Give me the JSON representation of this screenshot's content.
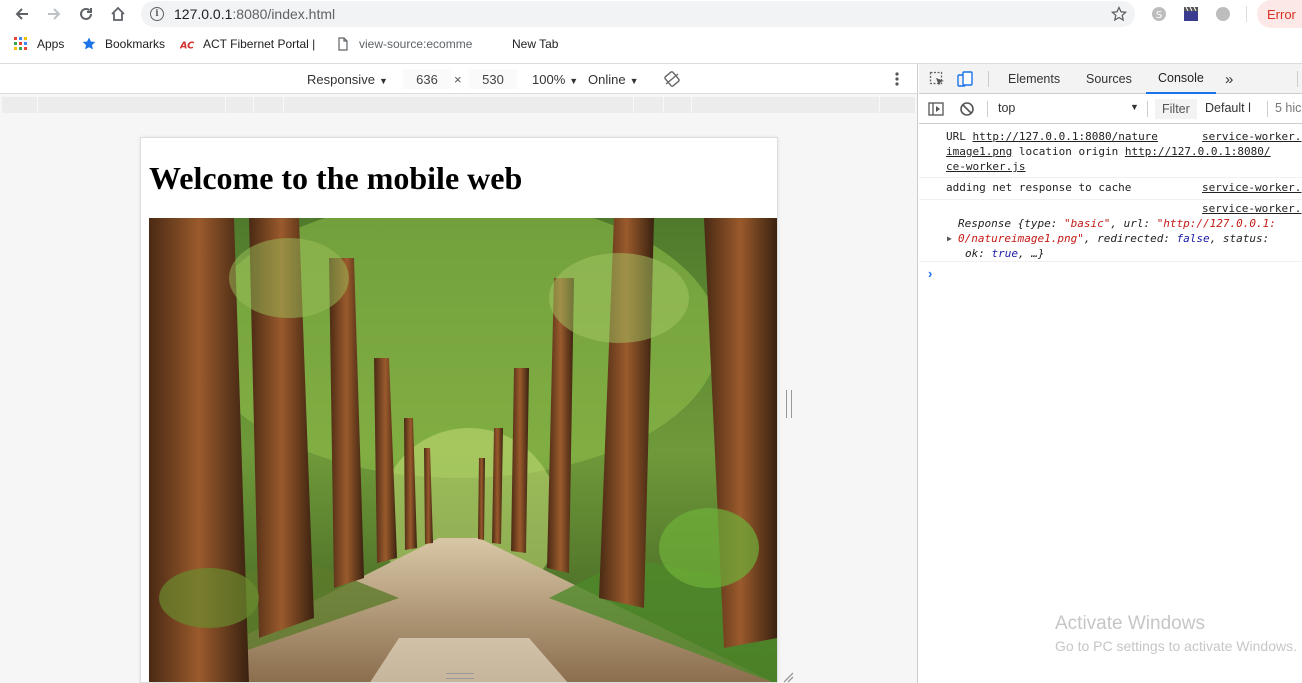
{
  "browser": {
    "url_host": "127.0.0.1",
    "url_rest": ":8080/index.html",
    "error_label": "Error"
  },
  "bookmarks": [
    {
      "label": "Apps",
      "icon": "apps-grid-icon"
    },
    {
      "label": "Bookmarks",
      "icon": "star-icon"
    },
    {
      "label": "ACT Fibernet Portal |",
      "icon": "act-logo-icon"
    },
    {
      "label": "view-source:ecomme",
      "icon": "page-icon"
    },
    {
      "label": "New Tab",
      "icon": ""
    }
  ],
  "device_toolbar": {
    "mode": "Responsive",
    "width": "636",
    "times": "×",
    "height": "530",
    "zoom": "100%",
    "network": "Online"
  },
  "page": {
    "heading": "Welcome to the mobile web"
  },
  "devtools": {
    "tabs": [
      "Elements",
      "Sources",
      "Console"
    ],
    "active_tab": "Console",
    "more": "»",
    "context": "top",
    "filter_placeholder": "Filter",
    "levels": "Default l",
    "hidden": "5 hic"
  },
  "console": {
    "log1": {
      "l1_text": "URL ",
      "l1_link": "http://127.0.0.1:8080/nature",
      "l2_link": "image1.png",
      "l2_text": " location origin ",
      "l2_link2": "http://127.0.0.1:8080/",
      "l3_link": "ce-worker.js",
      "source": "service-worker.j"
    },
    "log2": {
      "text": "adding net response to cache",
      "source": "service-worker.j"
    },
    "log3": {
      "source": "service-worker.j",
      "l1_a": "Response {type: ",
      "l1_b": "\"basic\"",
      "l1_c": ", url: ",
      "l1_d": "\"http://127.0.0.1:",
      "l2_a": "0/natureimage1.png\"",
      "l2_b": ", redirected: ",
      "l2_c": "false",
      "l2_d": ", status: ",
      "l3_a": "ok: ",
      "l3_b": "true",
      "l3_c": ", …}"
    },
    "prompt": "›"
  },
  "watermark": {
    "title": "Activate Windows",
    "subtitle": "Go to PC settings to activate Windows."
  }
}
